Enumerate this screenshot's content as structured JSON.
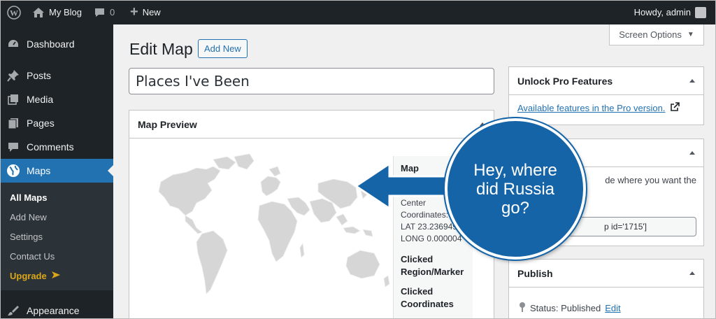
{
  "adminbar": {
    "site_name": "My Blog",
    "comments_count": "0",
    "new_label": "New",
    "howdy": "Howdy, admin"
  },
  "sidebar": {
    "items": [
      {
        "label": "Dashboard",
        "icon": "dashboard-icon"
      },
      {
        "label": "Posts",
        "icon": "pin-icon"
      },
      {
        "label": "Media",
        "icon": "media-icon"
      },
      {
        "label": "Pages",
        "icon": "pages-icon"
      },
      {
        "label": "Comments",
        "icon": "comment-icon"
      },
      {
        "label": "Maps",
        "icon": "globe-icon"
      },
      {
        "label": "Appearance",
        "icon": "brush-icon"
      }
    ],
    "submenu": [
      "All Maps",
      "Add New",
      "Settings",
      "Contact Us",
      "Upgrade"
    ]
  },
  "header": {
    "title": "Edit Map",
    "add_new": "Add New",
    "screen_options": "Screen Options"
  },
  "title_input": {
    "value": "Places I've Been"
  },
  "map_preview": {
    "title": "Map Preview",
    "info_title": "Map",
    "center_label": "Center Coordinates:",
    "lat": "LAT 23.236949",
    "long": "LONG 0.000004",
    "clicked_region": "Clicked Region/Marker",
    "clicked_coords": "Clicked Coordinates"
  },
  "unlock": {
    "title": "Unlock Pro Features",
    "link": "Available features in the Pro version."
  },
  "shortcode": {
    "text": "de where you want the",
    "code": "p id='1715']"
  },
  "publish": {
    "title": "Publish",
    "status": "Status: Published",
    "edit": "Edit"
  },
  "callout": {
    "text": "Hey, where did Russia go?"
  },
  "colors": {
    "accent": "#2271b1",
    "adminbar": "#1d2327",
    "callout": "#1664a8",
    "upgrade": "#dba617"
  }
}
